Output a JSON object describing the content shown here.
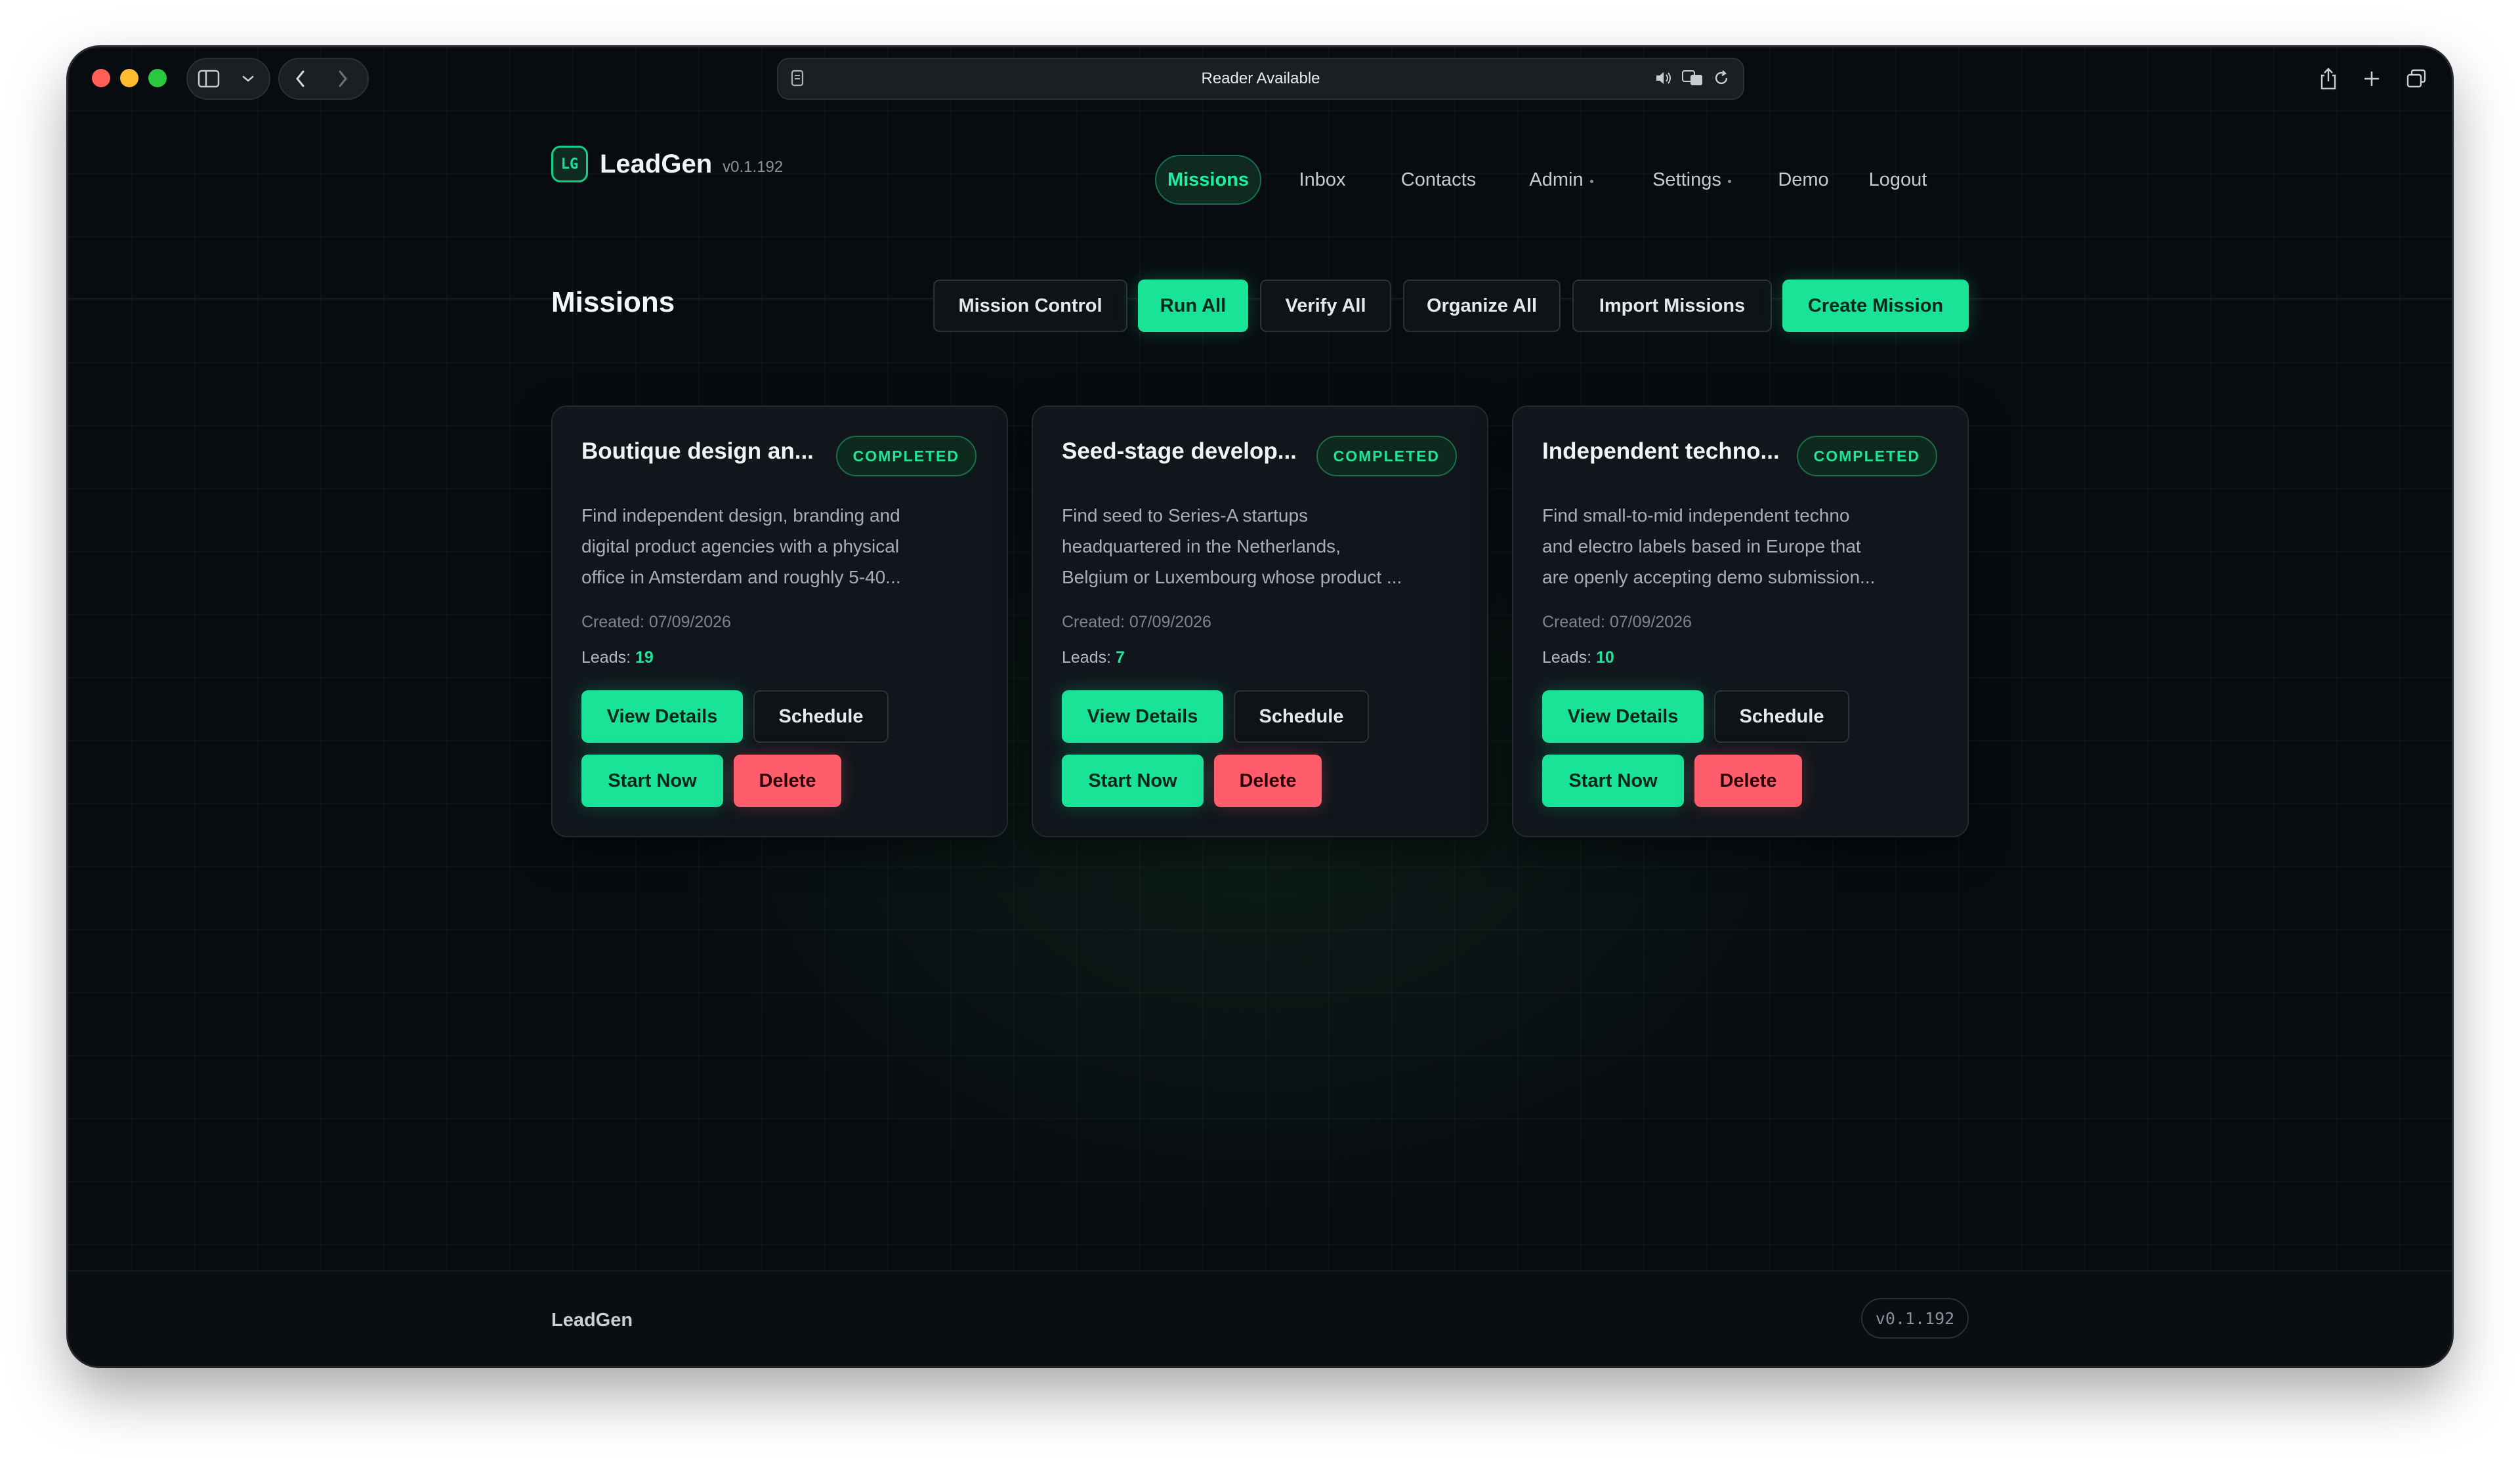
{
  "browser": {
    "address_text": "Reader Available",
    "icons": [
      "sidebar-icon",
      "chevron-down-icon",
      "back-icon",
      "forward-icon",
      "page-icon",
      "speaker-icon",
      "translate-icon",
      "reload-icon",
      "share-icon",
      "plus-icon",
      "tabs-icon"
    ]
  },
  "brand": {
    "logo": "LG",
    "name": "LeadGen",
    "version": "v0.1.192"
  },
  "nav": {
    "missions": "Missions",
    "inbox": "Inbox",
    "contacts": "Contacts",
    "admin": "Admin",
    "settings": "Settings",
    "demo": "Demo",
    "logout": "Logout"
  },
  "page": {
    "title": "Missions",
    "actions": {
      "mission_control": "Mission Control",
      "run_all": "Run All",
      "verify_all": "Verify All",
      "organize_all": "Organize All",
      "import_missions": "Import Missions",
      "create_mission": "Create Mission"
    }
  },
  "missions": [
    {
      "title": "Boutique design an...",
      "status": "COMPLETED",
      "desc1": "Find independent design, branding and",
      "desc2": "digital product agencies with a physical",
      "desc3": "office in Amsterdam and roughly 5-40...",
      "created_label": "Created: 07/09/2026",
      "leads_label": "Leads:",
      "leads": "19",
      "view": "View Details",
      "schedule": "Schedule",
      "start": "Start Now",
      "delete": "Delete"
    },
    {
      "title": "Seed-stage develop...",
      "status": "COMPLETED",
      "desc1": "Find seed to Series-A startups",
      "desc2": "headquartered in the Netherlands,",
      "desc3": "Belgium or Luxembourg whose product ...",
      "created_label": "Created: 07/09/2026",
      "leads_label": "Leads:",
      "leads": "7",
      "view": "View Details",
      "schedule": "Schedule",
      "start": "Start Now",
      "delete": "Delete"
    },
    {
      "title": "Independent techno...",
      "status": "COMPLETED",
      "desc1": "Find small-to-mid independent techno",
      "desc2": "and electro labels based in Europe that",
      "desc3": "are openly accepting demo submission...",
      "created_label": "Created: 07/09/2026",
      "leads_label": "Leads:",
      "leads": "10",
      "view": "View Details",
      "schedule": "Schedule",
      "start": "Start Now",
      "delete": "Delete"
    }
  ],
  "footer": {
    "brand": "LeadGen",
    "version": "v0.1.192"
  },
  "colors": {
    "accent": "#19e397",
    "danger": "#ff5c6c",
    "background": "#080c10"
  }
}
